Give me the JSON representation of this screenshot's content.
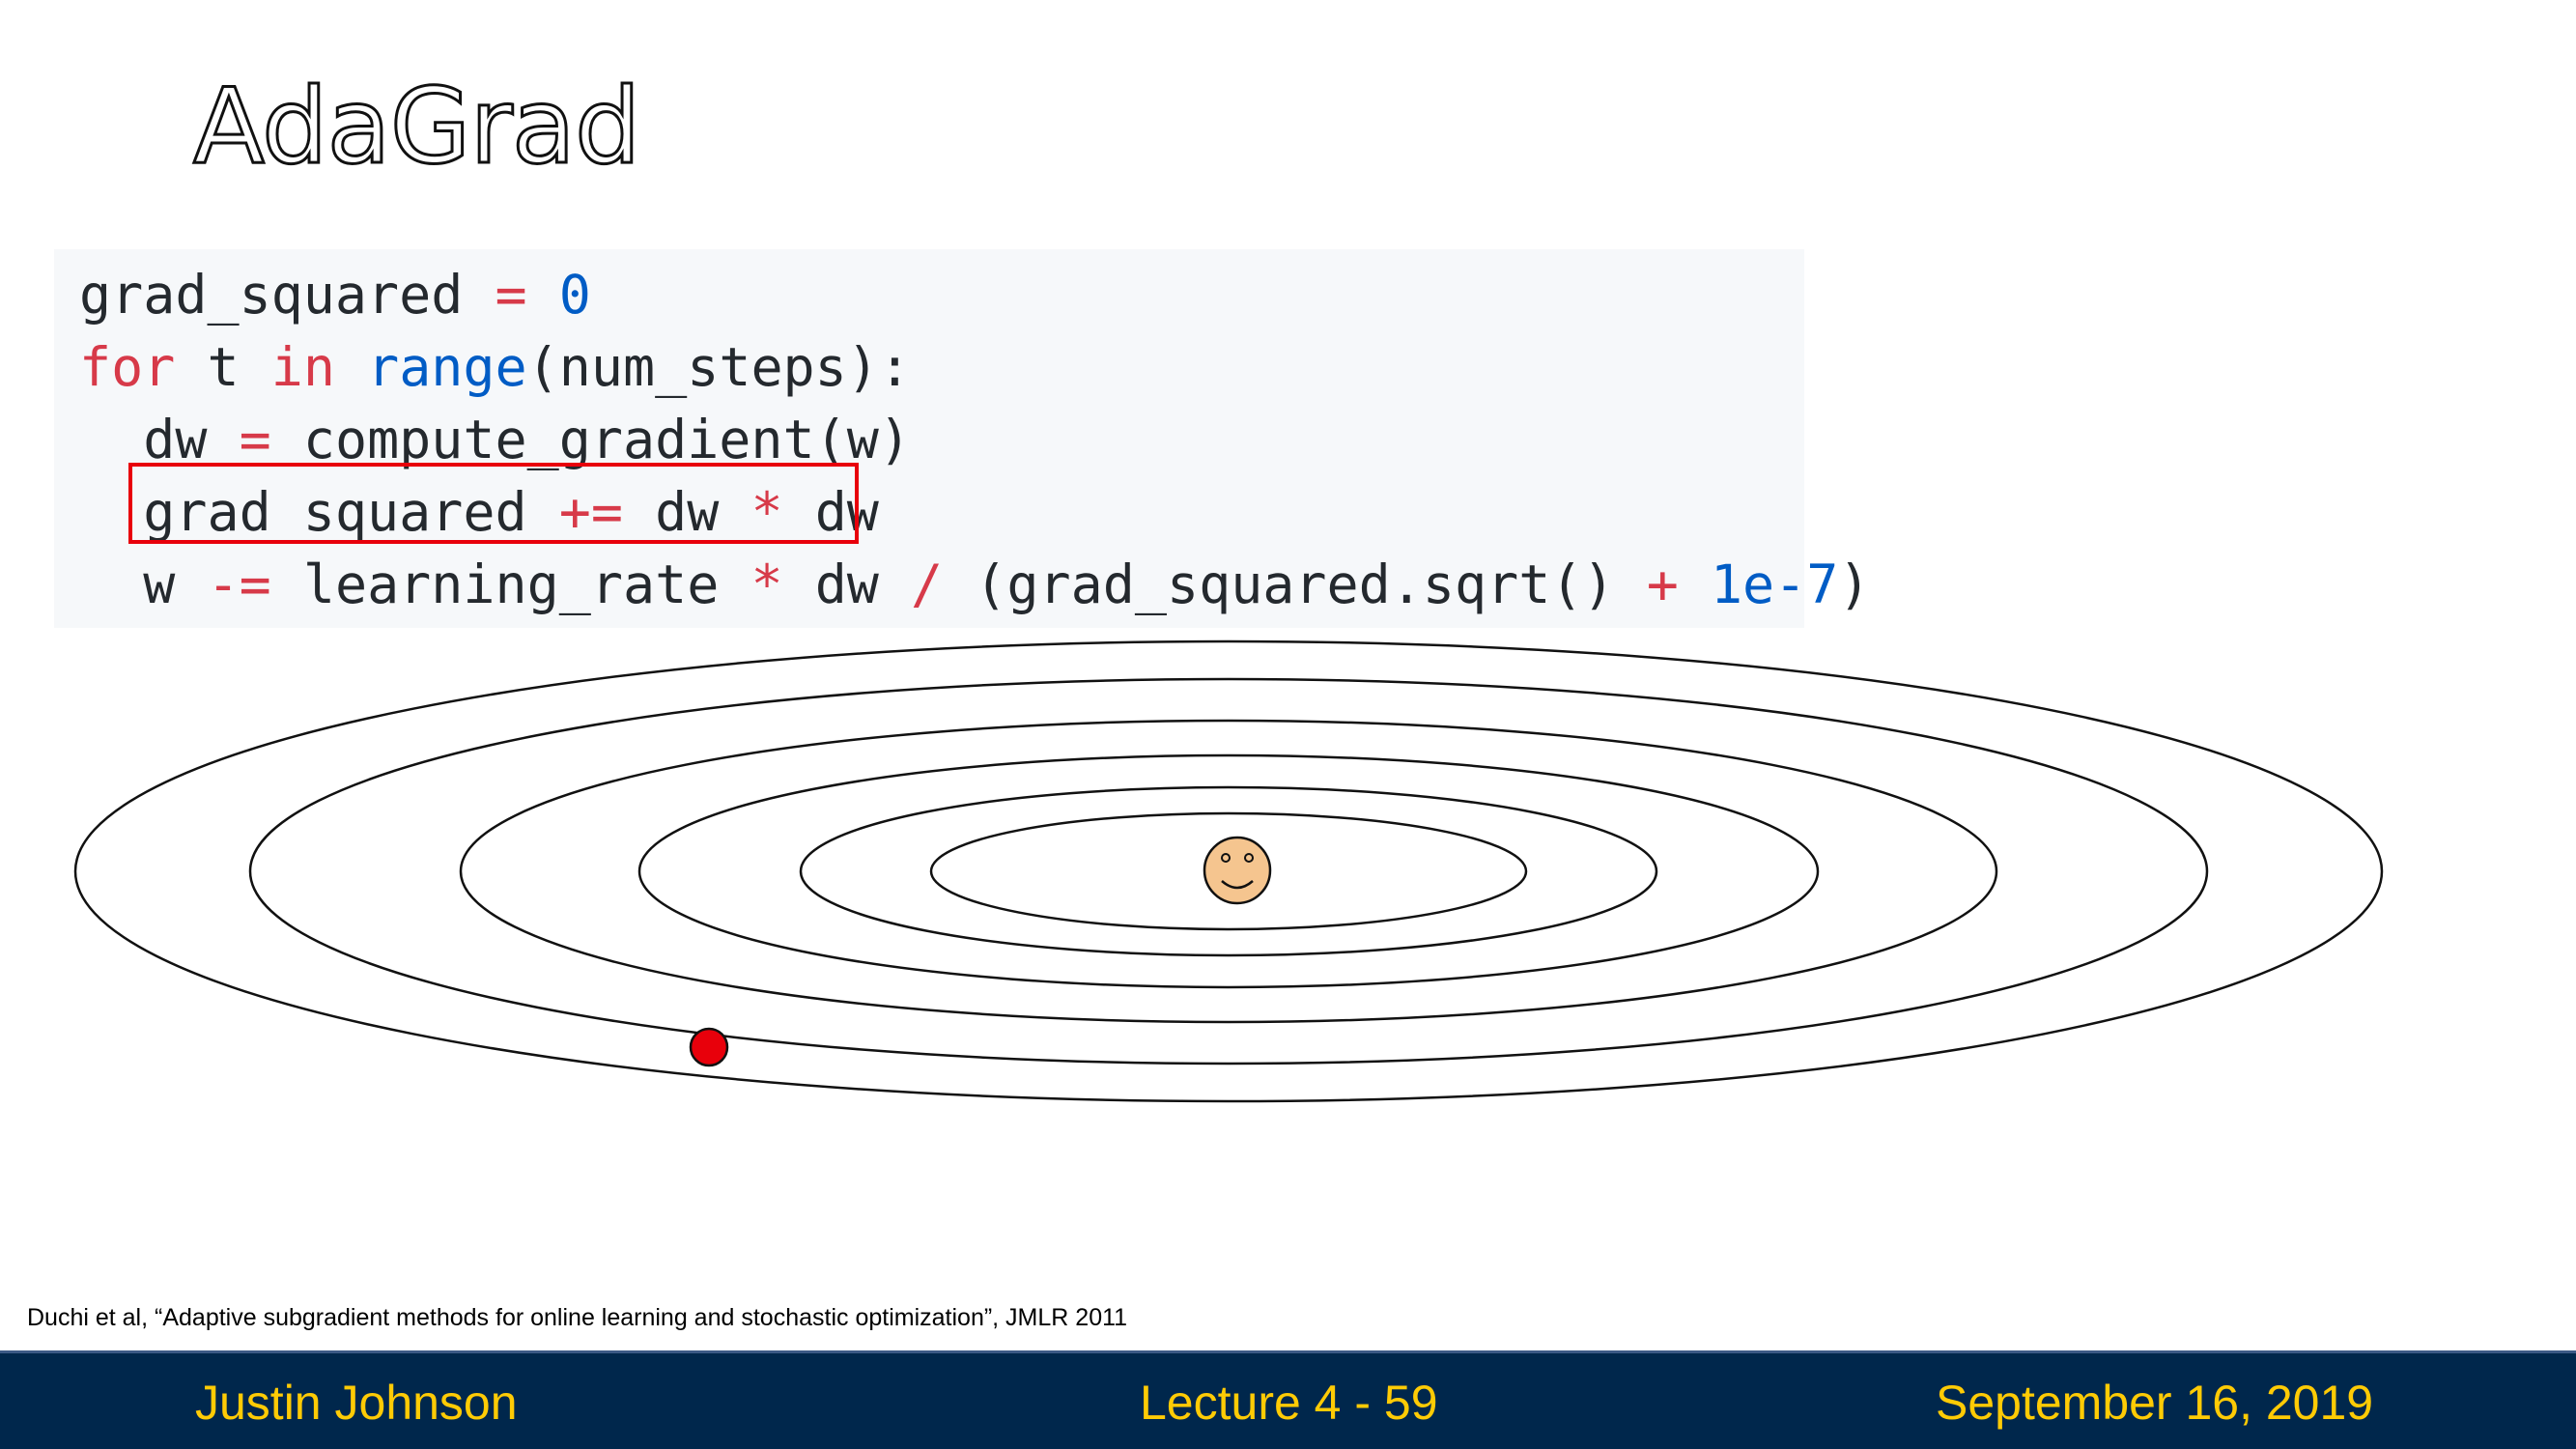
{
  "slide": {
    "title": "AdaGrad"
  },
  "code": {
    "line1": {
      "var": "grad_squared",
      "op": "=",
      "num": "0"
    },
    "line2": {
      "kw_for": "for",
      "var_t": "t",
      "kw_in": "in",
      "builtin": "range",
      "rest": "(num_steps):"
    },
    "line3": {
      "var": "dw",
      "op": "=",
      "call": "compute_gradient(w)"
    },
    "line4": {
      "var": "grad_squared",
      "op": "+=",
      "a": "dw",
      "mul": "*",
      "b": "dw"
    },
    "line5": {
      "var": "w",
      "op": "-=",
      "lr": "learning_rate",
      "mul": "*",
      "dw": "dw",
      "div": "/",
      "paren": "(grad_squared.sqrt()",
      "plus": "+",
      "eps": "1e-7",
      "close": ")"
    }
  },
  "illustration": {
    "contour_count": 6,
    "marker_colors": {
      "current_point": "#e8000b",
      "minimum_face": "#f5c58f"
    }
  },
  "citation": "Duchi et al, “Adaptive subgradient methods for online learning and stochastic optimization”, JMLR 2011",
  "footer": {
    "author": "Justin Johnson",
    "lecture": "Lecture 4 - 59",
    "date": "September 16, 2019"
  },
  "colors": {
    "footer_bg": "#00274c",
    "footer_text": "#ffcb05",
    "keyword": "#d73a49",
    "number": "#005cc5"
  }
}
